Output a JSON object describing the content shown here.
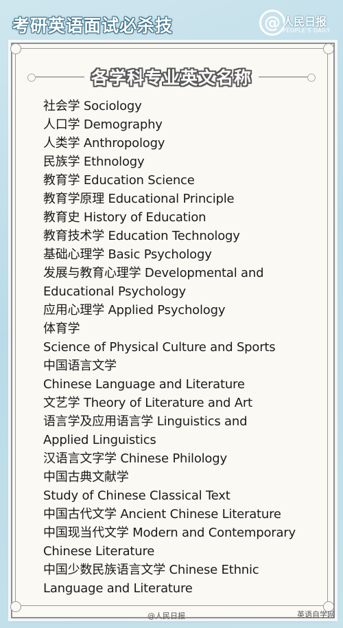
{
  "banner": {
    "title": "考研英语面试必杀技",
    "logo_symbol": "@",
    "logo_name": "人民日报",
    "logo_sub": "PEOPLE'S DAILY"
  },
  "card": {
    "title": "各学科专业英文名称",
    "lines": [
      "社会学 Sociology",
      "人口学 Demography",
      "人类学 Anthropology",
      "民族学 Ethnology",
      "教育学 Education Science",
      "教育学原理 Educational Principle",
      "教育史 History of Education",
      "教育技术学 Education Technology",
      "基础心理学 Basic Psychology",
      "发展与教育心理学 Developmental and",
      "Educational Psychology",
      "应用心理学 Applied Psychology",
      "体育学",
      "Science of Physical Culture and Sports",
      "中国语言文学",
      "Chinese Language and Literature",
      "文艺学 Theory of Literature and Art",
      "语言学及应用语言学 Linguistics and",
      "Applied Linguistics",
      "汉语言文字学 Chinese Philology",
      "中国古典文献学",
      "Study of Chinese Classical Text",
      "中国古代文学 Ancient Chinese Literature",
      "中国现当代文学 Modern and Contemporary",
      "Chinese Literature",
      "中国少数民族语言文学 Chinese Ethnic",
      "Language and Literature"
    ]
  },
  "watermarks": {
    "left": "@人民日报",
    "right": "英语自学网"
  }
}
